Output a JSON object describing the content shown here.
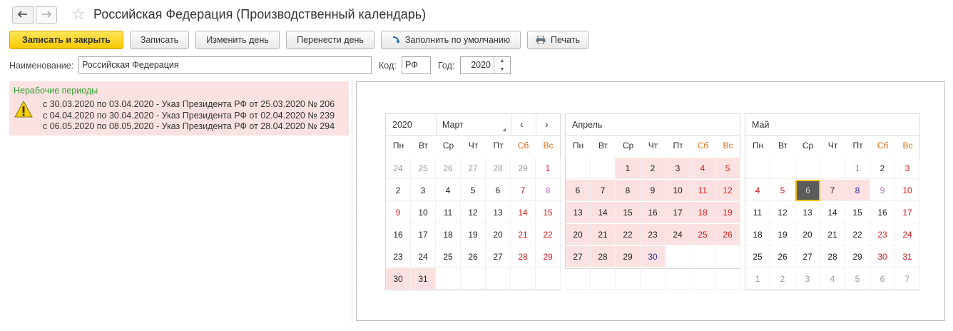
{
  "window": {
    "title": "Российская Федерация (Производственный календарь)"
  },
  "nav": {
    "back_icon": "arrow-left-icon",
    "forward_icon": "arrow-right-icon",
    "favorite_icon": "star-icon"
  },
  "toolbar": {
    "save_close": "Записать и закрыть",
    "save": "Записать",
    "change_day": "Изменить день",
    "move_day": "Перенести день",
    "fill_default": "Заполнить по умолчанию",
    "print": "Печать"
  },
  "fields": {
    "name_label": "Наименование:",
    "name_value": "Российская Федерация",
    "code_label": "Код:",
    "code_value": "РФ",
    "year_label": "Год:",
    "year_value": "2020"
  },
  "nonworking": {
    "title": "Нерабочие периоды",
    "lines": [
      "с 30.03.2020 по 03.04.2020 - Указ Президента РФ от 25.03.2020 № 206",
      "с 04.04.2020 по 30.04.2020 - Указ Президента РФ от 02.04.2020 № 239",
      "с 06.05.2020 по 08.05.2020 - Указ Президента РФ от 28.04.2020 № 294"
    ]
  },
  "weekdays": [
    "Пн",
    "Вт",
    "Ср",
    "Чт",
    "Пт",
    "Сб",
    "Вс"
  ],
  "calendar": {
    "year": "2020",
    "months": [
      {
        "name": "Март",
        "days": [
          [
            "24",
            "other",
            ""
          ],
          [
            "25",
            "other",
            ""
          ],
          [
            "26",
            "other",
            ""
          ],
          [
            "27",
            "other",
            ""
          ],
          [
            "28",
            "other",
            ""
          ],
          [
            "29",
            "other",
            ""
          ],
          [
            "1",
            "hol",
            ""
          ],
          [
            "2",
            "",
            ""
          ],
          [
            "3",
            "",
            ""
          ],
          [
            "4",
            "",
            ""
          ],
          [
            "5",
            "",
            ""
          ],
          [
            "6",
            "",
            ""
          ],
          [
            "7",
            "hol",
            ""
          ],
          [
            "8",
            "pre",
            ""
          ],
          [
            "9",
            "hol",
            ""
          ],
          [
            "10",
            "",
            ""
          ],
          [
            "11",
            "",
            ""
          ],
          [
            "12",
            "",
            ""
          ],
          [
            "13",
            "",
            ""
          ],
          [
            "14",
            "hol",
            ""
          ],
          [
            "15",
            "hol",
            ""
          ],
          [
            "16",
            "",
            ""
          ],
          [
            "17",
            "",
            ""
          ],
          [
            "18",
            "",
            ""
          ],
          [
            "19",
            "",
            ""
          ],
          [
            "20",
            "",
            ""
          ],
          [
            "21",
            "hol",
            ""
          ],
          [
            "22",
            "hol",
            ""
          ],
          [
            "23",
            "",
            ""
          ],
          [
            "24",
            "",
            ""
          ],
          [
            "25",
            "",
            ""
          ],
          [
            "26",
            "",
            ""
          ],
          [
            "27",
            "",
            ""
          ],
          [
            "28",
            "hol",
            ""
          ],
          [
            "29",
            "hol",
            ""
          ],
          [
            "30",
            "",
            "nw"
          ],
          [
            "31",
            "",
            "nw"
          ],
          [
            "",
            "",
            ""
          ],
          [
            "",
            "",
            ""
          ],
          [
            "",
            "",
            ""
          ],
          [
            "",
            "",
            ""
          ],
          [
            "",
            "",
            ""
          ]
        ]
      },
      {
        "name": "Апрель",
        "days": [
          [
            "",
            "",
            ""
          ],
          [
            "",
            "",
            ""
          ],
          [
            "1",
            "",
            "nw"
          ],
          [
            "2",
            "",
            "nw"
          ],
          [
            "3",
            "",
            "nw"
          ],
          [
            "4",
            "hol",
            "nw"
          ],
          [
            "5",
            "hol",
            "nw"
          ],
          [
            "6",
            "",
            "nw"
          ],
          [
            "7",
            "",
            "nw"
          ],
          [
            "8",
            "",
            "nw"
          ],
          [
            "9",
            "",
            "nw"
          ],
          [
            "10",
            "",
            "nw"
          ],
          [
            "11",
            "hol",
            "nw"
          ],
          [
            "12",
            "hol",
            "nw"
          ],
          [
            "13",
            "",
            "nw"
          ],
          [
            "14",
            "",
            "nw"
          ],
          [
            "15",
            "",
            "nw"
          ],
          [
            "16",
            "",
            "nw"
          ],
          [
            "17",
            "",
            "nw"
          ],
          [
            "18",
            "hol",
            "nw"
          ],
          [
            "19",
            "hol",
            "nw"
          ],
          [
            "20",
            "",
            "nw"
          ],
          [
            "21",
            "",
            "nw"
          ],
          [
            "22",
            "",
            "nw"
          ],
          [
            "23",
            "",
            "nw"
          ],
          [
            "24",
            "",
            "nw"
          ],
          [
            "25",
            "hol",
            "nw"
          ],
          [
            "26",
            "hol",
            "nw"
          ],
          [
            "27",
            "",
            "nw"
          ],
          [
            "28",
            "",
            "nw"
          ],
          [
            "29",
            "",
            "nw"
          ],
          [
            "30",
            "blue",
            "nw"
          ],
          [
            "",
            "",
            ""
          ],
          [
            "",
            "",
            ""
          ],
          [
            "",
            "",
            ""
          ],
          [
            "",
            "",
            ""
          ],
          [
            "",
            "",
            ""
          ],
          [
            "",
            "",
            ""
          ],
          [
            "",
            "",
            ""
          ],
          [
            "",
            "",
            ""
          ],
          [
            "",
            "",
            ""
          ],
          [
            "",
            "",
            ""
          ]
        ]
      },
      {
        "name": "Май",
        "days": [
          [
            "",
            "",
            ""
          ],
          [
            "",
            "",
            ""
          ],
          [
            "",
            "",
            ""
          ],
          [
            "",
            "",
            ""
          ],
          [
            "1",
            "pre",
            ""
          ],
          [
            "2",
            "",
            ""
          ],
          [
            "3",
            "hol",
            ""
          ],
          [
            "4",
            "hol",
            ""
          ],
          [
            "5",
            "hol",
            ""
          ],
          [
            "6",
            "",
            "sel"
          ],
          [
            "7",
            "",
            "nw"
          ],
          [
            "8",
            "blue",
            "nw"
          ],
          [
            "9",
            "pre",
            ""
          ],
          [
            "10",
            "hol",
            ""
          ],
          [
            "11",
            "",
            ""
          ],
          [
            "12",
            "",
            ""
          ],
          [
            "13",
            "",
            ""
          ],
          [
            "14",
            "",
            ""
          ],
          [
            "15",
            "",
            ""
          ],
          [
            "16",
            "",
            ""
          ],
          [
            "17",
            "hol",
            ""
          ],
          [
            "18",
            "",
            ""
          ],
          [
            "19",
            "",
            ""
          ],
          [
            "20",
            "",
            ""
          ],
          [
            "21",
            "",
            ""
          ],
          [
            "22",
            "",
            ""
          ],
          [
            "23",
            "hol",
            ""
          ],
          [
            "24",
            "hol",
            ""
          ],
          [
            "25",
            "",
            ""
          ],
          [
            "26",
            "",
            ""
          ],
          [
            "27",
            "",
            ""
          ],
          [
            "28",
            "",
            ""
          ],
          [
            "29",
            "",
            ""
          ],
          [
            "30",
            "hol",
            ""
          ],
          [
            "31",
            "hol",
            ""
          ],
          [
            "1",
            "other",
            ""
          ],
          [
            "2",
            "other",
            ""
          ],
          [
            "3",
            "other",
            ""
          ],
          [
            "4",
            "other",
            ""
          ],
          [
            "5",
            "other",
            ""
          ],
          [
            "6",
            "other",
            ""
          ],
          [
            "7",
            "other",
            ""
          ]
        ]
      }
    ]
  }
}
